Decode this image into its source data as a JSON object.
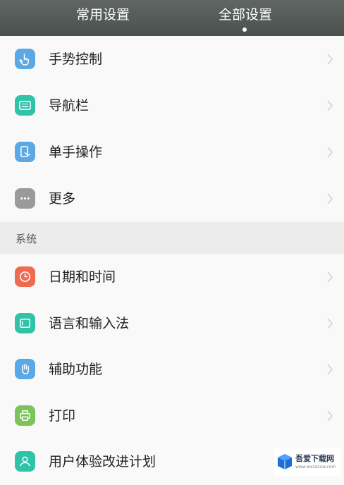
{
  "tabs": {
    "common": "常用设置",
    "all": "全部设置"
  },
  "colors": {
    "topbar": "#545b58",
    "gesture": "#5aa9e6",
    "navbar": "#2fc3a7",
    "one_hand": "#5aa9e6",
    "more": "#9a9a9a",
    "datetime": "#f06a4f",
    "language": "#2fc3a7",
    "accessibility": "#5aa9e6",
    "print": "#7cc35a",
    "user_experience": "#2fc3a7"
  },
  "rows_top": [
    {
      "label": "手势控制",
      "icon": "hand-tap-icon"
    },
    {
      "label": "导航栏",
      "icon": "navbar-icon"
    },
    {
      "label": "单手操作",
      "icon": "phone-hand-icon"
    },
    {
      "label": "更多",
      "icon": "more-dots-icon"
    }
  ],
  "section": {
    "title": "系统"
  },
  "rows_system": [
    {
      "label": "日期和时间",
      "icon": "clock-icon"
    },
    {
      "label": "语言和输入法",
      "icon": "keyboard-icon"
    },
    {
      "label": "辅助功能",
      "icon": "hand-icon"
    },
    {
      "label": "打印",
      "icon": "printer-icon"
    },
    {
      "label": "用户体验改进计划",
      "icon": "user-icon"
    }
  ],
  "watermark": {
    "name": "吾爱下载网",
    "url": "www.wxzazaw.com"
  }
}
